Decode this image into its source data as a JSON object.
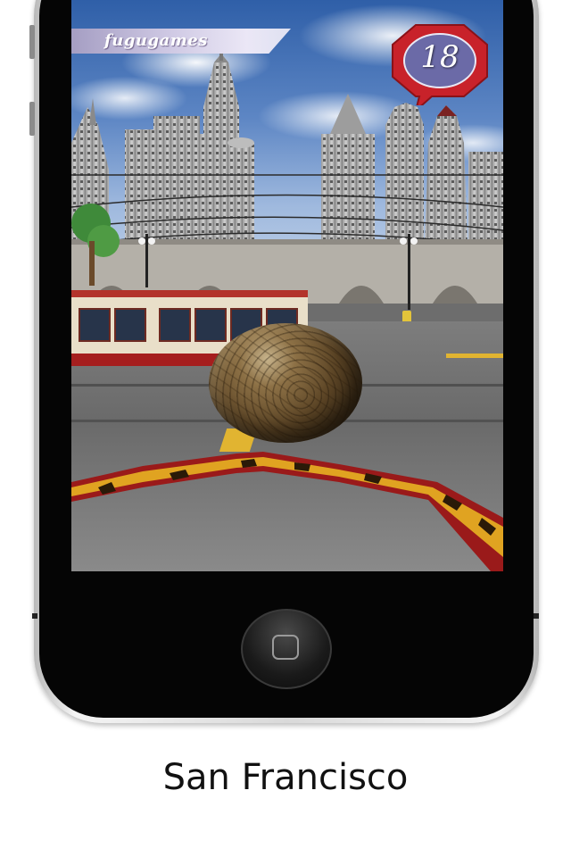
{
  "device": {
    "type": "smartphone",
    "home_button_icon": "rounded-square-icon"
  },
  "game": {
    "brand": "fugugames",
    "score": "18",
    "scene": {
      "player_object": "stone-ball",
      "vehicle": "cable-car"
    }
  },
  "caption": "San Francisco",
  "colors": {
    "badge_red": "#c8222a",
    "badge_inner": "#6b6aa7",
    "guard_yellow": "#e0a321",
    "guard_red": "#9a1a1a",
    "tram_red": "#a51e1e"
  }
}
